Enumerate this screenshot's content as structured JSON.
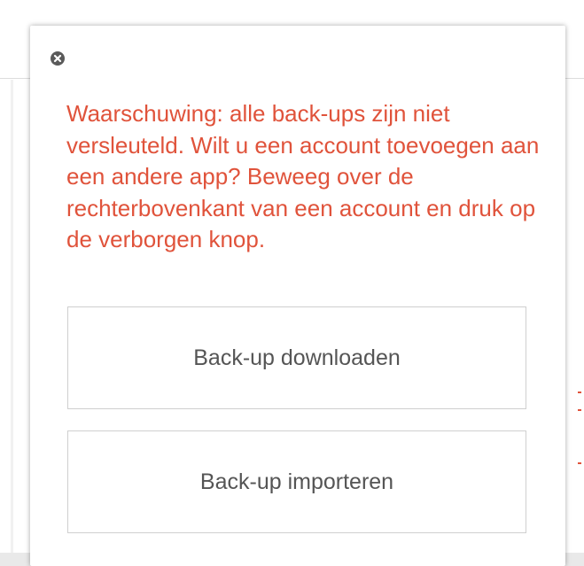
{
  "dialog": {
    "warning_text": "Waarschuwing: alle back-ups zijn niet versleuteld. Wilt u een account toevoegen aan een andere app? Beweeg over de rechterbovenkant van een account en druk op de verborgen knop.",
    "download_button_label": "Back-up downloaden",
    "import_button_label": "Back-up importeren",
    "close_icon": "close-icon"
  },
  "colors": {
    "warning": "#e0533b",
    "button_text": "#555555",
    "button_border": "#cfcfcf",
    "close_icon_bg": "#5a5a5a"
  }
}
